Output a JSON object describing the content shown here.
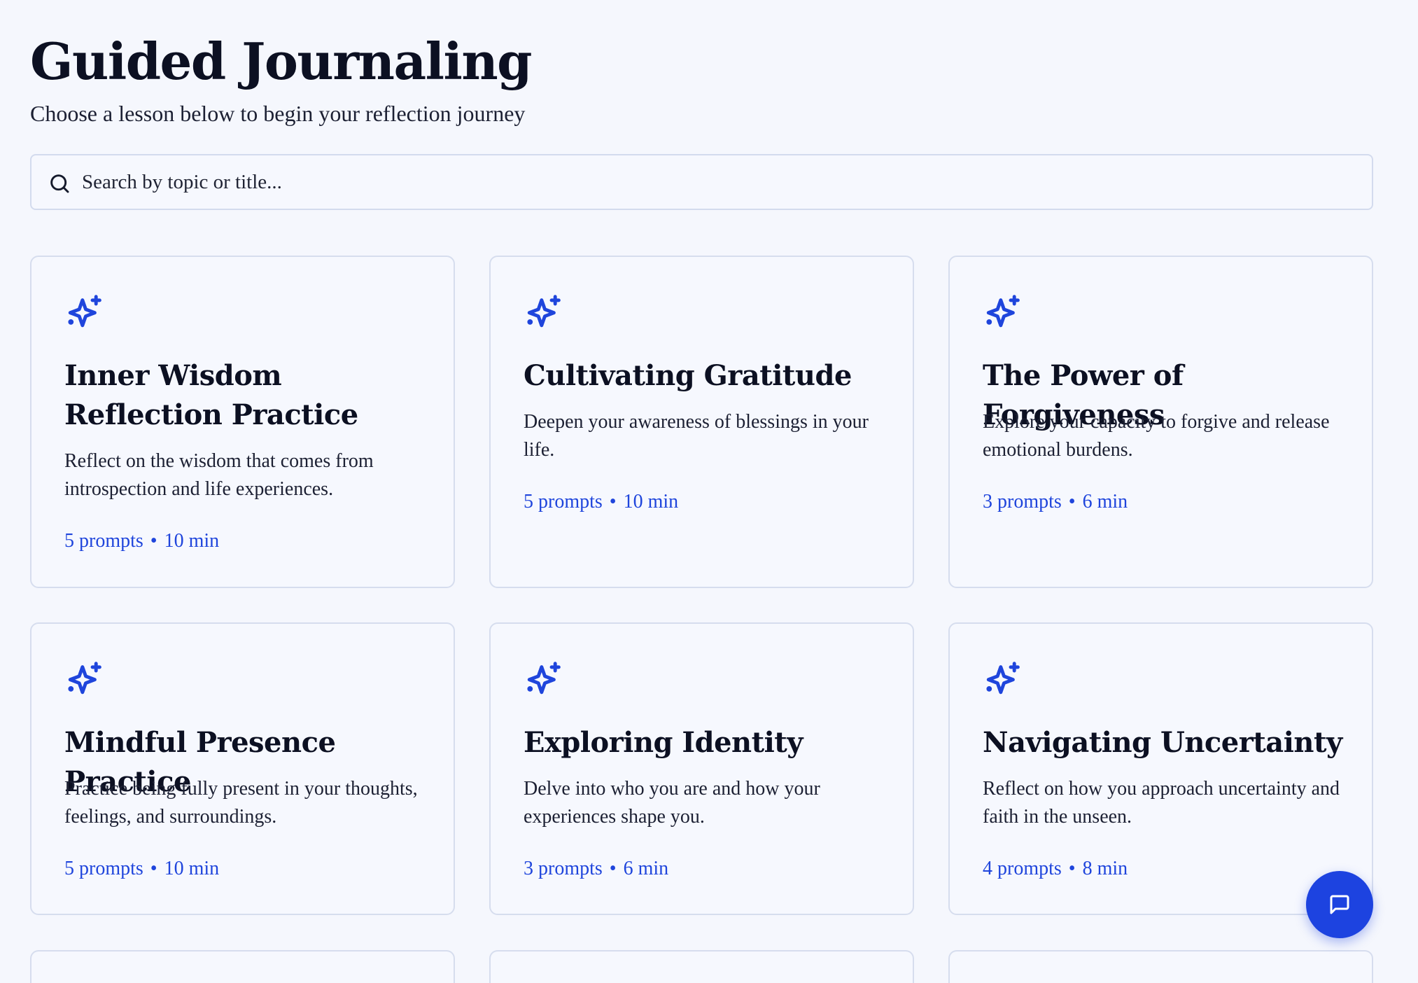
{
  "header": {
    "title": "Guided Journaling",
    "subtitle": "Choose a lesson below to begin your reflection journey"
  },
  "search": {
    "placeholder": "Search by topic or title...",
    "icon": "search-icon"
  },
  "lessons": [
    {
      "icon": "sparkle-icon",
      "title": "Inner Wisdom Reflection Practice",
      "description": "Reflect on the wisdom that comes from introspection and life experiences.",
      "prompts": "5 prompts",
      "separator": "•",
      "duration": "10 min"
    },
    {
      "icon": "sparkle-icon",
      "title": "Cultivating Gratitude",
      "description": "Deepen your awareness of blessings in your life.",
      "prompts": "5 prompts",
      "separator": "•",
      "duration": "10 min"
    },
    {
      "icon": "sparkle-icon",
      "title": "The Power of Forgiveness",
      "description": "Explore your capacity to forgive and release emotional burdens.",
      "prompts": "3 prompts",
      "separator": "•",
      "duration": "6 min"
    },
    {
      "icon": "sparkle-icon",
      "title": "Mindful Presence Practice",
      "description": "Practice being fully present in your thoughts, feelings, and surroundings.",
      "prompts": "5 prompts",
      "separator": "•",
      "duration": "10 min"
    },
    {
      "icon": "sparkle-icon",
      "title": "Exploring Identity",
      "description": "Delve into who you are and how your experiences shape you.",
      "prompts": "3 prompts",
      "separator": "•",
      "duration": "6 min"
    },
    {
      "icon": "sparkle-icon",
      "title": "Navigating Uncertainty",
      "description": "Reflect on how you approach uncertainty and faith in the unseen.",
      "prompts": "4 prompts",
      "separator": "•",
      "duration": "8 min"
    }
  ],
  "chat_button": {
    "icon": "chat-icon"
  },
  "colors": {
    "accent": "#1d43e0",
    "background": "#f5f7fd",
    "card_border": "#d6ddee",
    "text": "#0c1022"
  }
}
